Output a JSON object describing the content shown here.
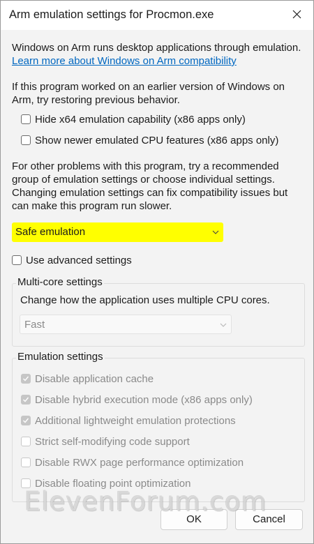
{
  "window": {
    "title": "Arm emulation settings for Procmon.exe"
  },
  "intro": {
    "text": "Windows on Arm runs desktop applications through emulation.",
    "link": "Learn more about Windows on Arm compatibility"
  },
  "restore": {
    "text": "If this program worked on an earlier version of Windows on Arm, try restoring previous behavior.",
    "options": [
      {
        "label": "Hide x64 emulation capability (x86 apps only)",
        "checked": false
      },
      {
        "label": "Show newer emulated CPU features (x86 apps only)",
        "checked": false
      }
    ]
  },
  "recommend": {
    "text": "For other problems with this program, try a recommended group of emulation settings or choose individual settings. Changing emulation settings can fix compatibility issues but can make this program run slower."
  },
  "preset": {
    "value": "Safe emulation",
    "highlight_color": "#ffff00"
  },
  "advanced": {
    "label": "Use advanced settings",
    "checked": false
  },
  "multicore": {
    "title": "Multi-core settings",
    "description": "Change how the application uses multiple CPU cores.",
    "value": "Fast"
  },
  "emulation": {
    "title": "Emulation settings",
    "options": [
      {
        "label": "Disable application cache",
        "checked": true
      },
      {
        "label": "Disable hybrid execution mode (x86 apps only)",
        "checked": true
      },
      {
        "label": "Additional lightweight emulation protections",
        "checked": true
      },
      {
        "label": "Strict self-modifying code support",
        "checked": false
      },
      {
        "label": "Disable RWX page performance optimization",
        "checked": false
      },
      {
        "label": "Disable floating point optimization",
        "checked": false
      }
    ]
  },
  "buttons": {
    "ok": "OK",
    "cancel": "Cancel"
  },
  "watermark": "ElevenForum.com",
  "icons": {
    "close": "close-icon",
    "chevron": "chevron-down-icon",
    "check": "checkmark-icon"
  }
}
